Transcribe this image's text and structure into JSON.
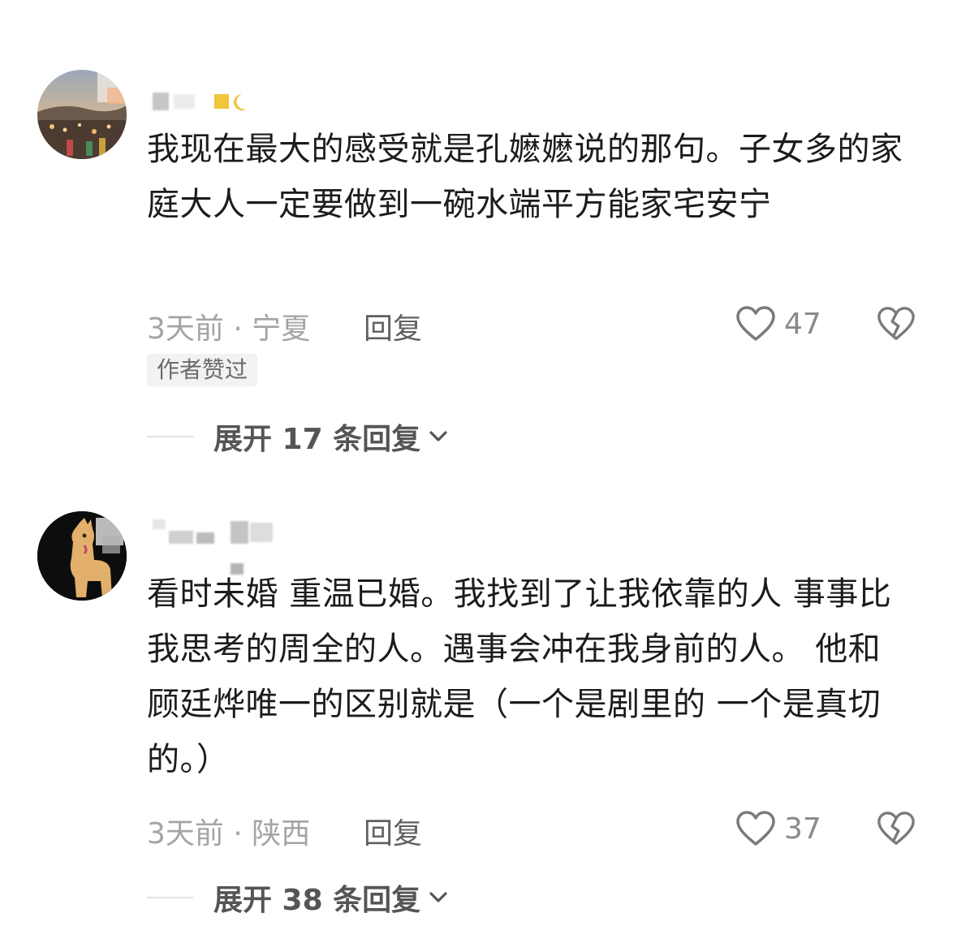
{
  "comments": [
    {
      "text": "我现在最大的感受就是孔嬷嬷说的那句。子女多的家庭大人一定要做到一碗水端平方能家宅安宁",
      "meta": "3天前 · 宁夏",
      "reply_label": "回复",
      "likes": "47",
      "badge": "作者赞过",
      "expand_label": "展开 17 条回复",
      "avatar_icon": "landscape-avatar",
      "name_icon": "moon-icon"
    },
    {
      "text": "看时未婚 重温已婚。我找到了让我依靠的人 事事比我思考的周全的人。遇事会冲在我身前的人。 他和顾廷烨唯一的区别就是（一个是剧里的 一个是真切的。）",
      "meta": "3天前 · 陕西",
      "reply_label": "回复",
      "likes": "37",
      "expand_label": "展开 38 条回复",
      "avatar_icon": "alpaca-avatar"
    }
  ],
  "colors": {
    "text": "#1c1c1c",
    "meta": "#a4a4a4",
    "icon": "#7a7a7a"
  }
}
